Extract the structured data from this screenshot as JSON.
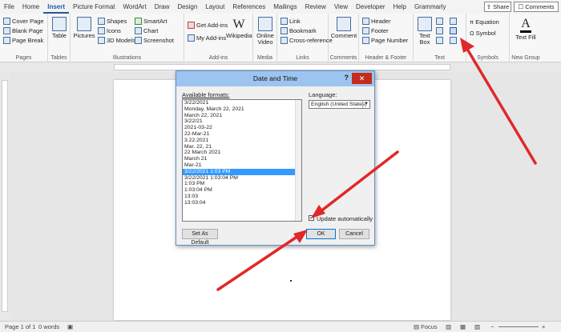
{
  "tabs": [
    "File",
    "Home",
    "Insert",
    "Picture Format",
    "WordArt",
    "Draw",
    "Design",
    "Layout",
    "References",
    "Mailings",
    "Review",
    "View",
    "Developer",
    "Help",
    "Grammarly"
  ],
  "active_tab": "Insert",
  "share_label": "Share",
  "comments_label": "Comments",
  "ribbon": {
    "pages": {
      "items": [
        "Cover Page",
        "Blank Page",
        "Page Break"
      ],
      "label": "Pages"
    },
    "tables": {
      "button": "Table",
      "label": "Tables"
    },
    "illustrations": {
      "pictures": "Pictures",
      "items": [
        "Shapes",
        "Icons",
        "3D Models"
      ],
      "items2": [
        "SmartArt",
        "Chart",
        "Screenshot"
      ],
      "label": "Illustrations"
    },
    "addins": {
      "items": [
        "Get Add-ins",
        "My Add-ins"
      ],
      "wikipedia": "Wikipedia",
      "label": "Add-ins"
    },
    "media": {
      "button": "Online Video",
      "label": "Media"
    },
    "links": {
      "items": [
        "Link",
        "Bookmark",
        "Cross-reference"
      ],
      "label": "Links"
    },
    "comments": {
      "button": "Comment",
      "label": "Comments"
    },
    "header_footer": {
      "items": [
        "Header",
        "Footer",
        "Page Number"
      ],
      "label": "Header & Footer"
    },
    "text": {
      "textbox": "Text Box",
      "label": "Text"
    },
    "symbols": {
      "items": [
        "Equation",
        "Symbol"
      ],
      "label": "Symbols"
    },
    "new_group": {
      "button": "Text Fill",
      "label": "New Group"
    }
  },
  "dialog": {
    "title": "Date and Time",
    "help": "?",
    "close": "✕",
    "available_label": "Available formats:",
    "formats": [
      "3/22/2021",
      "Monday, March 22, 2021",
      "March 22, 2021",
      "3/22/21",
      "2021-03-22",
      "22-Mar-21",
      "3.22.2021",
      "Mar. 22, 21",
      "22 March 2021",
      "March 21",
      "Mar-21",
      "3/22/2021 1:03 PM",
      "3/22/2021 1:03:04 PM",
      "1:03 PM",
      "1:03:04 PM",
      "13:03",
      "13:03:04"
    ],
    "selected_index": 11,
    "language_label": "Language:",
    "language_value": "English (United States)",
    "update_label": "Update automatically",
    "update_checked": true,
    "set_default_label": "Set As Default",
    "ok_label": "OK",
    "cancel_label": "Cancel"
  },
  "status": {
    "page": "Page 1 of 1",
    "words": "0 words",
    "focus": "Focus"
  },
  "colors": {
    "accent": "#2b579a",
    "arrow": "#e0282a",
    "title_bar": "#9cc4ef",
    "selection": "#3399ff"
  }
}
